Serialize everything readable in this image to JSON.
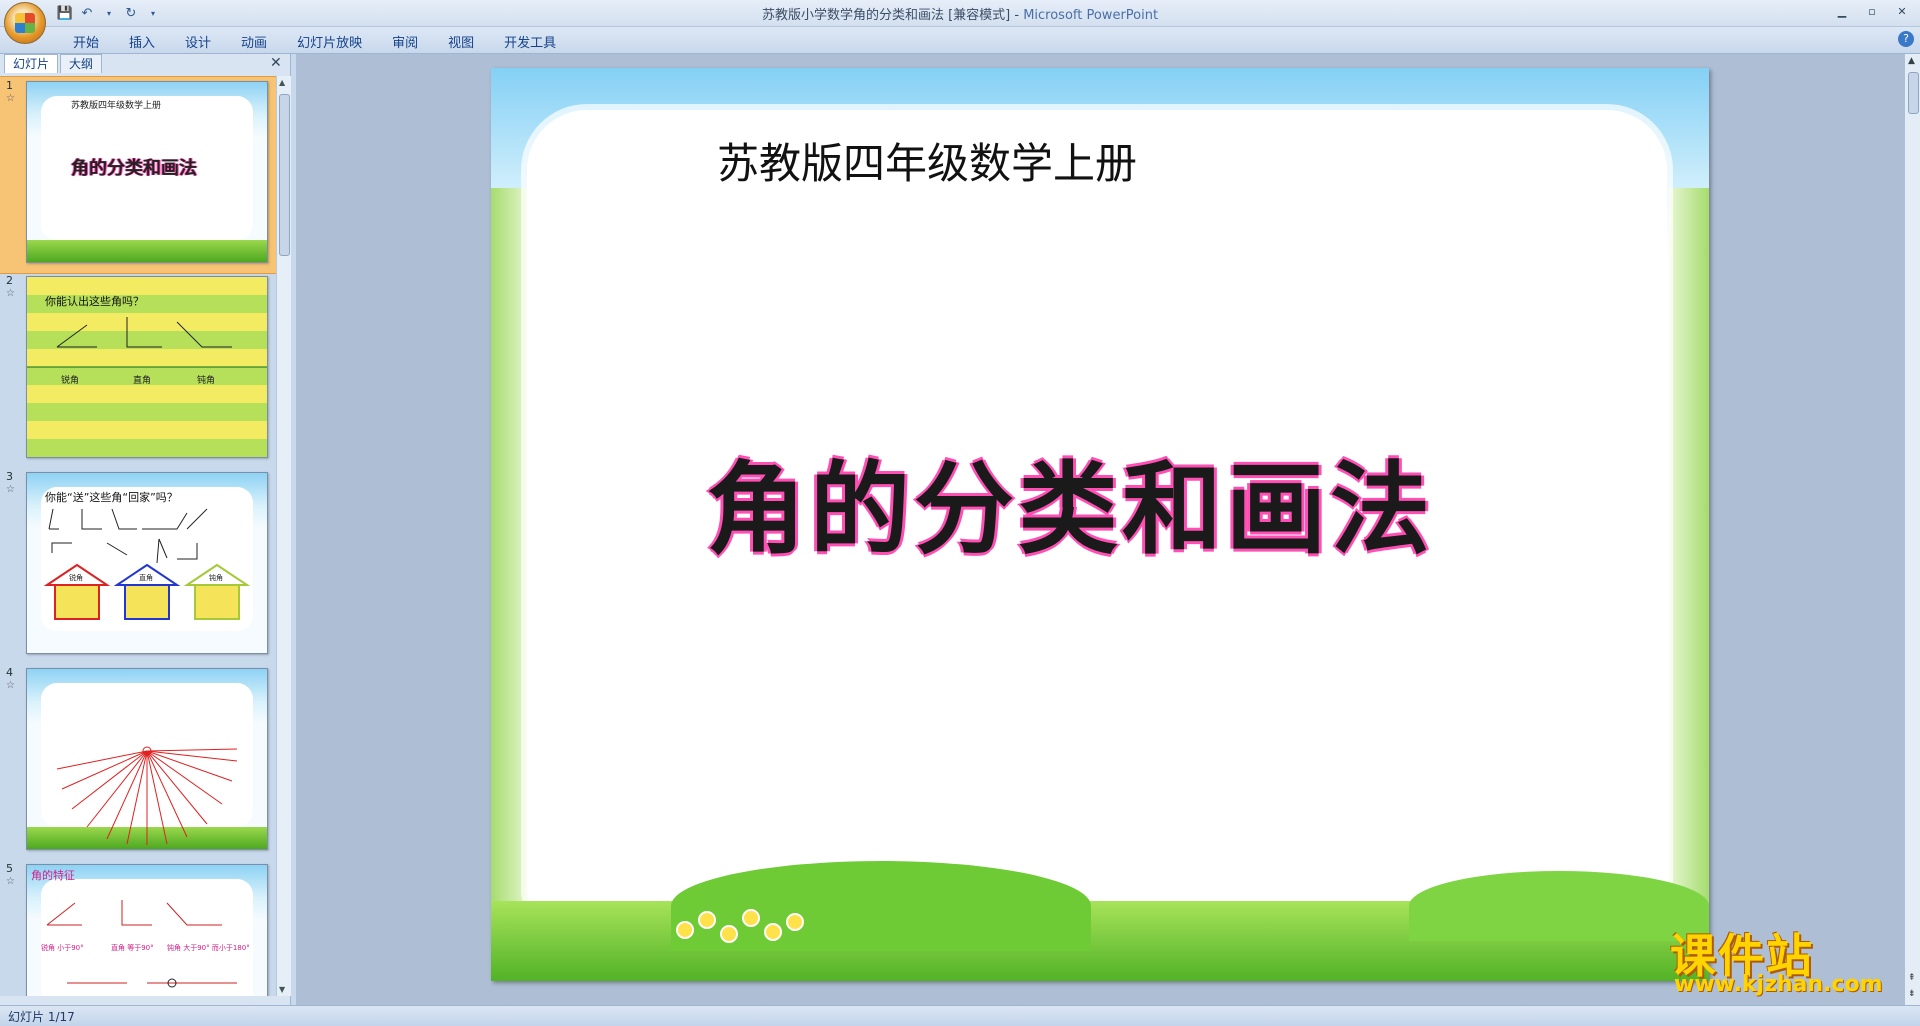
{
  "window": {
    "title_doc": "苏教版小学数学角的分类和画法 [兼容模式]",
    "title_sep": " - ",
    "title_app": "Microsoft PowerPoint"
  },
  "ribbon": {
    "tabs": [
      "开始",
      "插入",
      "设计",
      "动画",
      "幻灯片放映",
      "审阅",
      "视图",
      "开发工具"
    ]
  },
  "pane": {
    "tabs": [
      "幻灯片",
      "大纲"
    ],
    "slides": [
      {
        "num": "1",
        "lines": [
          "苏教版四年级数学上册",
          "角的分类和画法"
        ]
      },
      {
        "num": "2",
        "lines": [
          "你能认出这些角吗？",
          "锐角",
          "直角",
          "钝角"
        ]
      },
      {
        "num": "3",
        "lines": [
          "你能“送”这些角“回家”吗？",
          "锐角",
          "直角",
          "钝角"
        ]
      },
      {
        "num": "4",
        "lines": []
      },
      {
        "num": "5",
        "lines": [
          "角的特征",
          "锐角 小于90°",
          "直角 等于90°",
          "钝角 大于90° 而小于180°"
        ]
      }
    ]
  },
  "slide": {
    "subtitle": "苏教版四年级数学上册",
    "title": "角的分类和画法"
  },
  "status": {
    "text": "幻灯片 1/17"
  },
  "watermark": {
    "cn": "课件站",
    "url": "www.kjzhan.com"
  },
  "colors": {
    "title_outline": "#ff4fb4",
    "selected_thumb": "#f7c374",
    "watermark": "#ffd400"
  }
}
